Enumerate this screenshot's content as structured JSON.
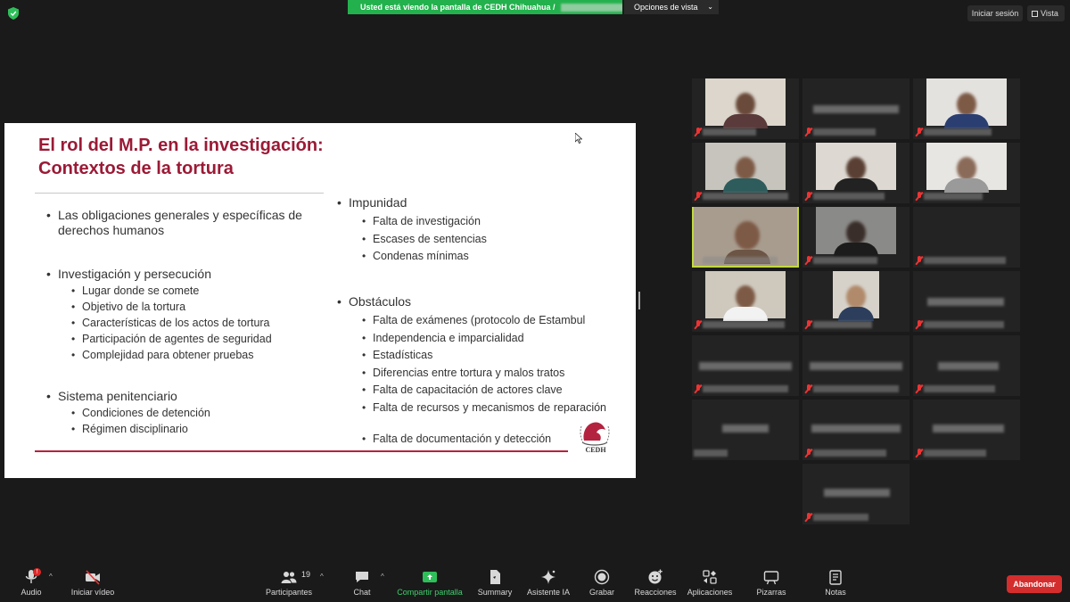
{
  "top_bar": {
    "share_banner": "Usted está viendo la pantalla de CEDH Chihuahua /",
    "view_options": "Opciones de vista",
    "sign_in": "Iniciar sesión",
    "view": "Vista"
  },
  "slide": {
    "title_line1": "El rol del M.P. en la investigación:",
    "title_line2": "Contextos de la tortura",
    "left": {
      "b1": "Las obligaciones generales y específicas de derechos humanos",
      "b2": "Investigación y persecución",
      "b2_items": [
        "Lugar donde se comete",
        "Objetivo de la tortura",
        "Características de los actos de tortura",
        "Participación de agentes de seguridad",
        "Complejidad para obtener pruebas"
      ],
      "b3": "Sistema penitenciario",
      "b3_items": [
        "Condiciones de detención",
        "Régimen disciplinario"
      ]
    },
    "right": {
      "b1": "Impunidad",
      "b1_items": [
        "Falta de investigación",
        "Escases de sentencias",
        "Condenas mínimas"
      ],
      "b2": "Obstáculos",
      "b2_items": [
        "Falta de exámenes (protocolo de Estambul",
        "Independencia e imparcialidad",
        "Estadísticas",
        "Diferencias entre tortura y malos tratos",
        "Falta de capacitación de actores clave",
        "Falta de recursos y mecanismos de reparación",
        "Falta de documentación y detección"
      ]
    },
    "logo_text": "CEDH"
  },
  "toolbar": {
    "audio": "Audio",
    "audio_badge": "!",
    "video": "Iniciar vídeo",
    "participants": "Participantes",
    "participants_count": "19",
    "chat": "Chat",
    "share": "Compartir pantalla",
    "summary": "Summary",
    "ai": "Asistente IA",
    "record": "Grabar",
    "reactions": "Reacciones",
    "apps": "Aplicaciones",
    "whiteboards": "Pizarras",
    "notes": "Notas",
    "leave": "Abandonar"
  },
  "colors": {
    "share_green": "#23b14d",
    "title_red": "#9b1a36",
    "leave_red": "#d42d2d",
    "active_speaker": "#c2d940"
  }
}
